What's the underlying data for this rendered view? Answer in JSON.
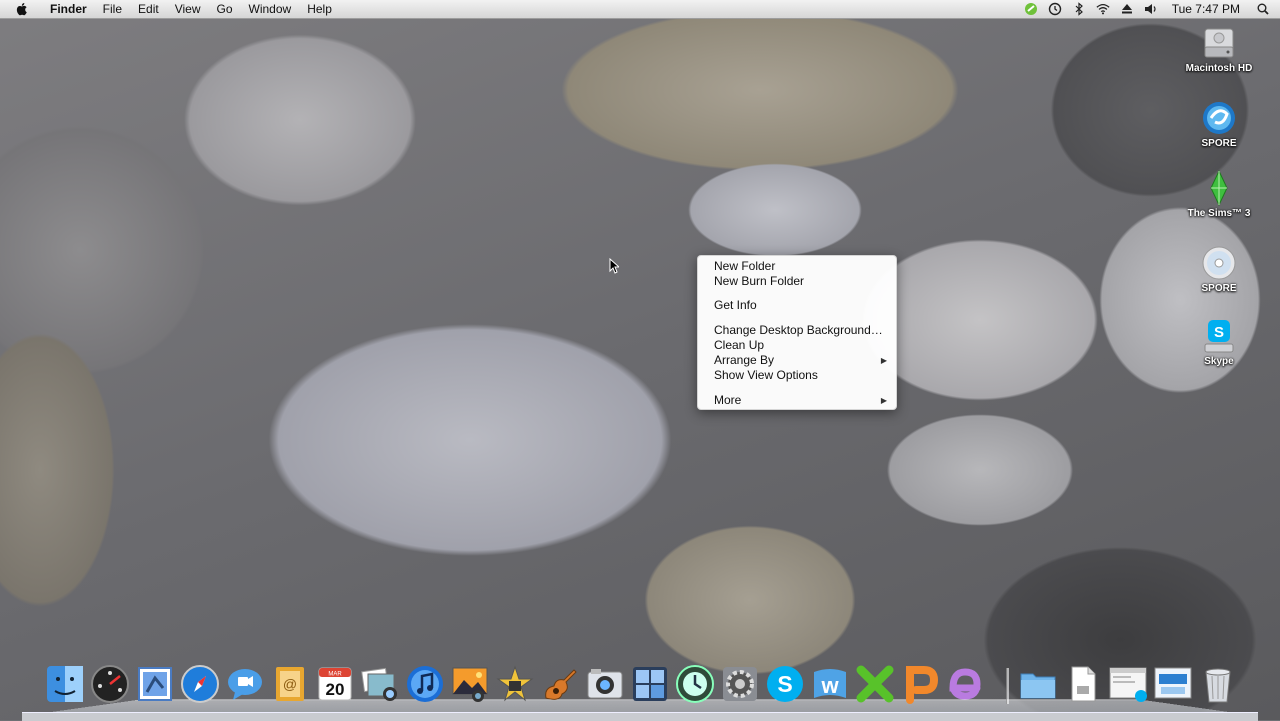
{
  "menubar": {
    "app_name": "Finder",
    "menus": [
      "File",
      "Edit",
      "View",
      "Go",
      "Window",
      "Help"
    ],
    "clock": "Tue 7:47 PM"
  },
  "status_icons": [
    "bamboo-green-icon",
    "time-machine-icon",
    "bluetooth-icon",
    "wifi-icon",
    "eject-icon",
    "volume-icon"
  ],
  "context_menu": {
    "items": [
      {
        "label": "New Folder",
        "submenu": false
      },
      {
        "label": "New Burn Folder",
        "submenu": false
      },
      {
        "label": "Get Info",
        "submenu": false
      },
      {
        "label": "Change Desktop Background…",
        "submenu": false
      },
      {
        "label": "Clean Up",
        "submenu": false
      },
      {
        "label": "Arrange By",
        "submenu": true
      },
      {
        "label": "Show View Options",
        "submenu": false
      },
      {
        "label": "More",
        "submenu": true
      }
    ]
  },
  "desktop_icons": [
    {
      "label": "Macintosh HD",
      "icon": "hard-drive-icon"
    },
    {
      "label": "SPORE",
      "icon": "spore-app-icon"
    },
    {
      "label": "The Sims™ 3",
      "icon": "sims-plumbob-icon"
    },
    {
      "label": "SPORE",
      "icon": "cd-disc-icon"
    },
    {
      "label": "Skype",
      "icon": "skype-drive-icon"
    }
  ],
  "dock": {
    "calendar_month": "MAR",
    "calendar_day": "20",
    "items": [
      "finder",
      "dashboard",
      "mail",
      "safari",
      "ichat",
      "address-book",
      "ical",
      "iphoto-preview",
      "itunes",
      "iphoto",
      "imovie",
      "garageband",
      "photo-booth",
      "spaces",
      "time-machine",
      "system-preferences",
      "skype",
      "word",
      "excel",
      "powerpoint",
      "entourage",
      "folder",
      "documents",
      "preview-window",
      "spore-window",
      "trash"
    ]
  },
  "colors": {
    "menubar": "#e4e4e4",
    "highlight": "#3875d7",
    "skype": "#00aff0"
  }
}
